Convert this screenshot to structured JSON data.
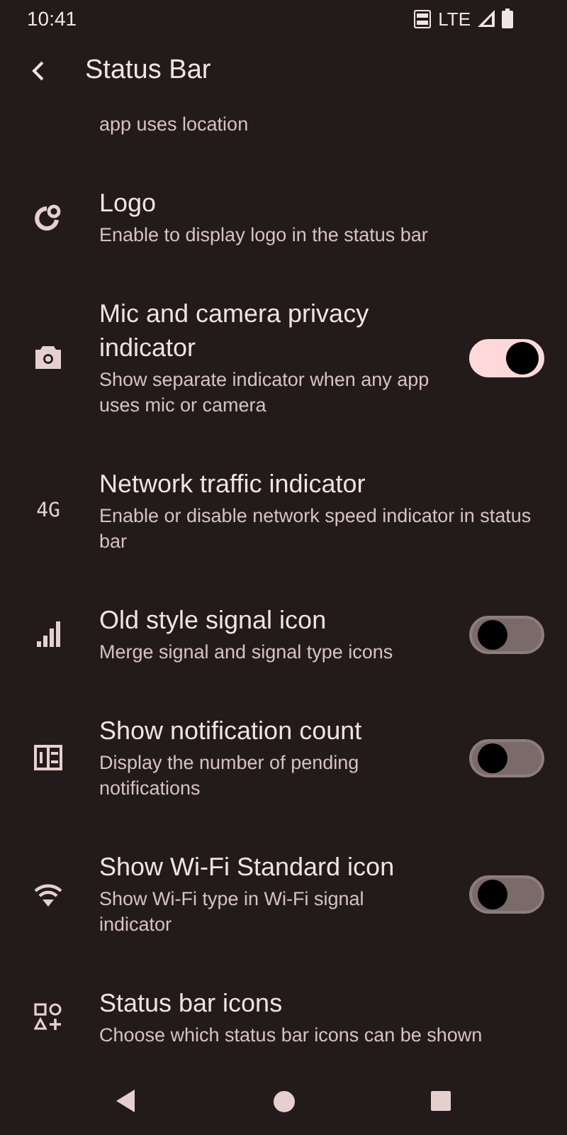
{
  "status_bar": {
    "time": "10:41",
    "network": "LTE"
  },
  "app_bar": {
    "title": "Status Bar"
  },
  "partial_summary": "app uses location",
  "rows": [
    {
      "kind": "plain",
      "title": "Logo",
      "summary": "Enable to display logo in the status bar"
    },
    {
      "kind": "switch",
      "title": "Mic and camera privacy indicator",
      "summary": "Show separate indicator when any app uses mic or camera",
      "on": true
    },
    {
      "kind": "plain",
      "icon_label": "4G",
      "title": "Network traffic indicator",
      "summary": "Enable or disable network speed indicator in status bar"
    },
    {
      "kind": "switch",
      "title": "Old style signal icon",
      "summary": "Merge signal and signal type icons",
      "on": false
    },
    {
      "kind": "switch",
      "title": "Show notification count",
      "summary": "Display the number of pending notifications",
      "on": false
    },
    {
      "kind": "switch",
      "title": "Show Wi-Fi Standard icon",
      "summary": "Show Wi-Fi type in Wi-Fi signal indicator",
      "on": false
    },
    {
      "kind": "plain",
      "title": "Status bar icons",
      "summary": "Choose which status bar icons can be shown"
    }
  ]
}
